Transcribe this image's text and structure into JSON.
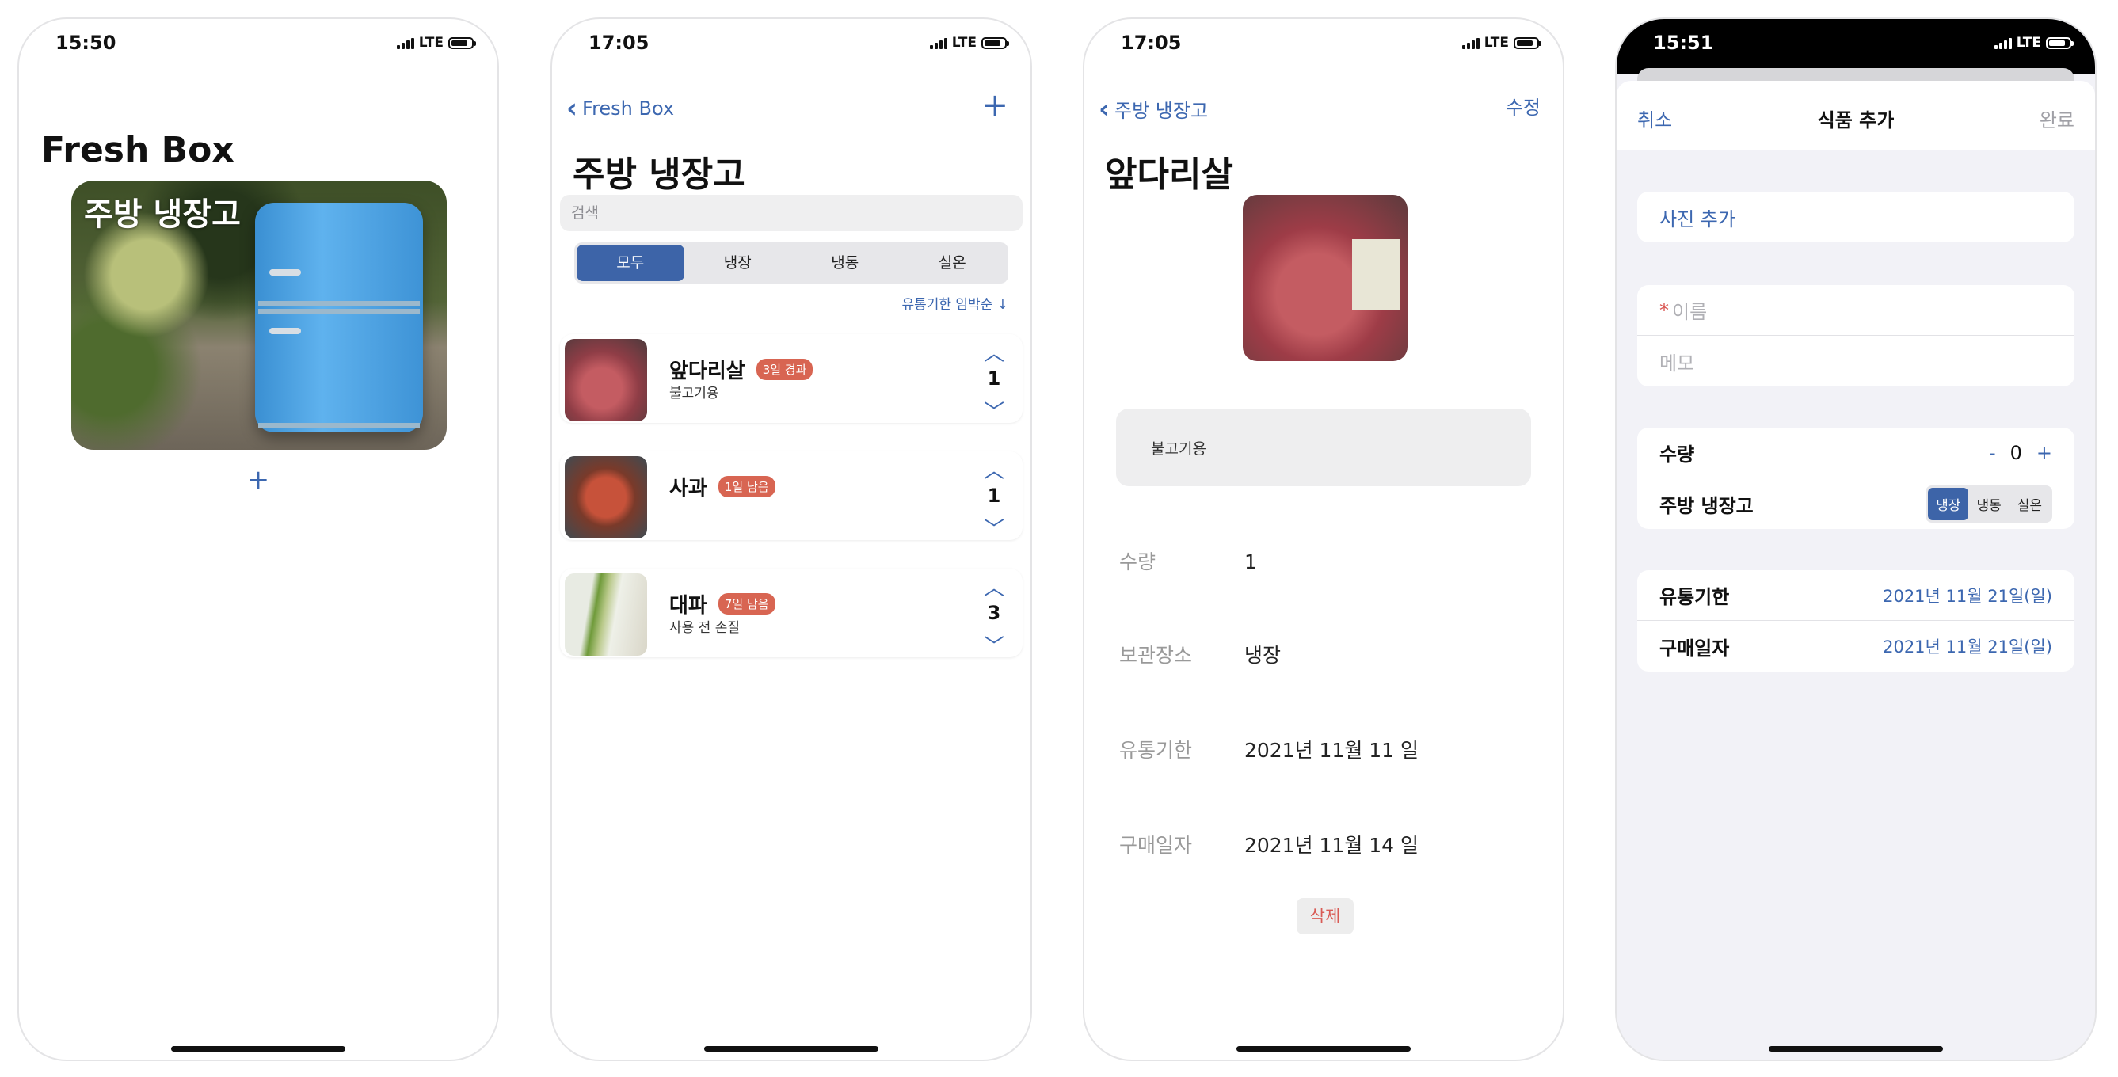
{
  "screen1": {
    "time": "15:50",
    "network": "LTE",
    "title": "Fresh Box",
    "fridge_card_title": "주방 냉장고",
    "add_label": "+"
  },
  "screen2": {
    "time": "17:05",
    "network": "LTE",
    "back_label": "Fresh Box",
    "add_label": "+",
    "title": "주방 냉장고",
    "search_placeholder": "검색",
    "segments": [
      "모두",
      "냉장",
      "냉동",
      "실온"
    ],
    "selected_segment": "모두",
    "sort_label": "유통기한 임박순 ↓",
    "items": [
      {
        "name": "앞다리살",
        "badge": "3일 경과",
        "note": "불고기용",
        "quantity": "1"
      },
      {
        "name": "사과",
        "badge": "1일 남음",
        "note": "",
        "quantity": "1"
      },
      {
        "name": "대파",
        "badge": "7일 남음",
        "note": "사용 전 손질",
        "quantity": "3"
      }
    ],
    "colors": {
      "accent": "#3d64a8",
      "badge": "#d86552"
    }
  },
  "screen3": {
    "time": "17:05",
    "network": "LTE",
    "back_label": "주방 냉장고",
    "edit_label": "수정",
    "title": "앞다리살",
    "memo": "불고기용",
    "fields": [
      {
        "label": "수량",
        "value": "1"
      },
      {
        "label": "보관장소",
        "value": "냉장"
      },
      {
        "label": "유통기한",
        "value": "2021년 11월 11 일"
      },
      {
        "label": "구매일자",
        "value": "2021년 11월 14 일"
      }
    ],
    "delete_label": "삭제"
  },
  "screen4": {
    "time": "15:51",
    "network": "LTE",
    "cancel_label": "취소",
    "title": "식품 추가",
    "done_label": "완료",
    "add_photo_label": "사진 추가",
    "name_placeholder": "이름",
    "required_mark": "*",
    "memo_placeholder": "메모",
    "quantity_label": "수량",
    "quantity_minus": "-",
    "quantity_value": "0",
    "quantity_plus": "+",
    "storage_label": "주방 냉장고",
    "storage_options": [
      "냉장",
      "냉동",
      "실온"
    ],
    "storage_selected": "냉장",
    "expiry_label": "유통기한",
    "expiry_value": "2021년 11월 21일(일)",
    "purchase_label": "구매일자",
    "purchase_value": "2021년 11월 21일(일)"
  }
}
